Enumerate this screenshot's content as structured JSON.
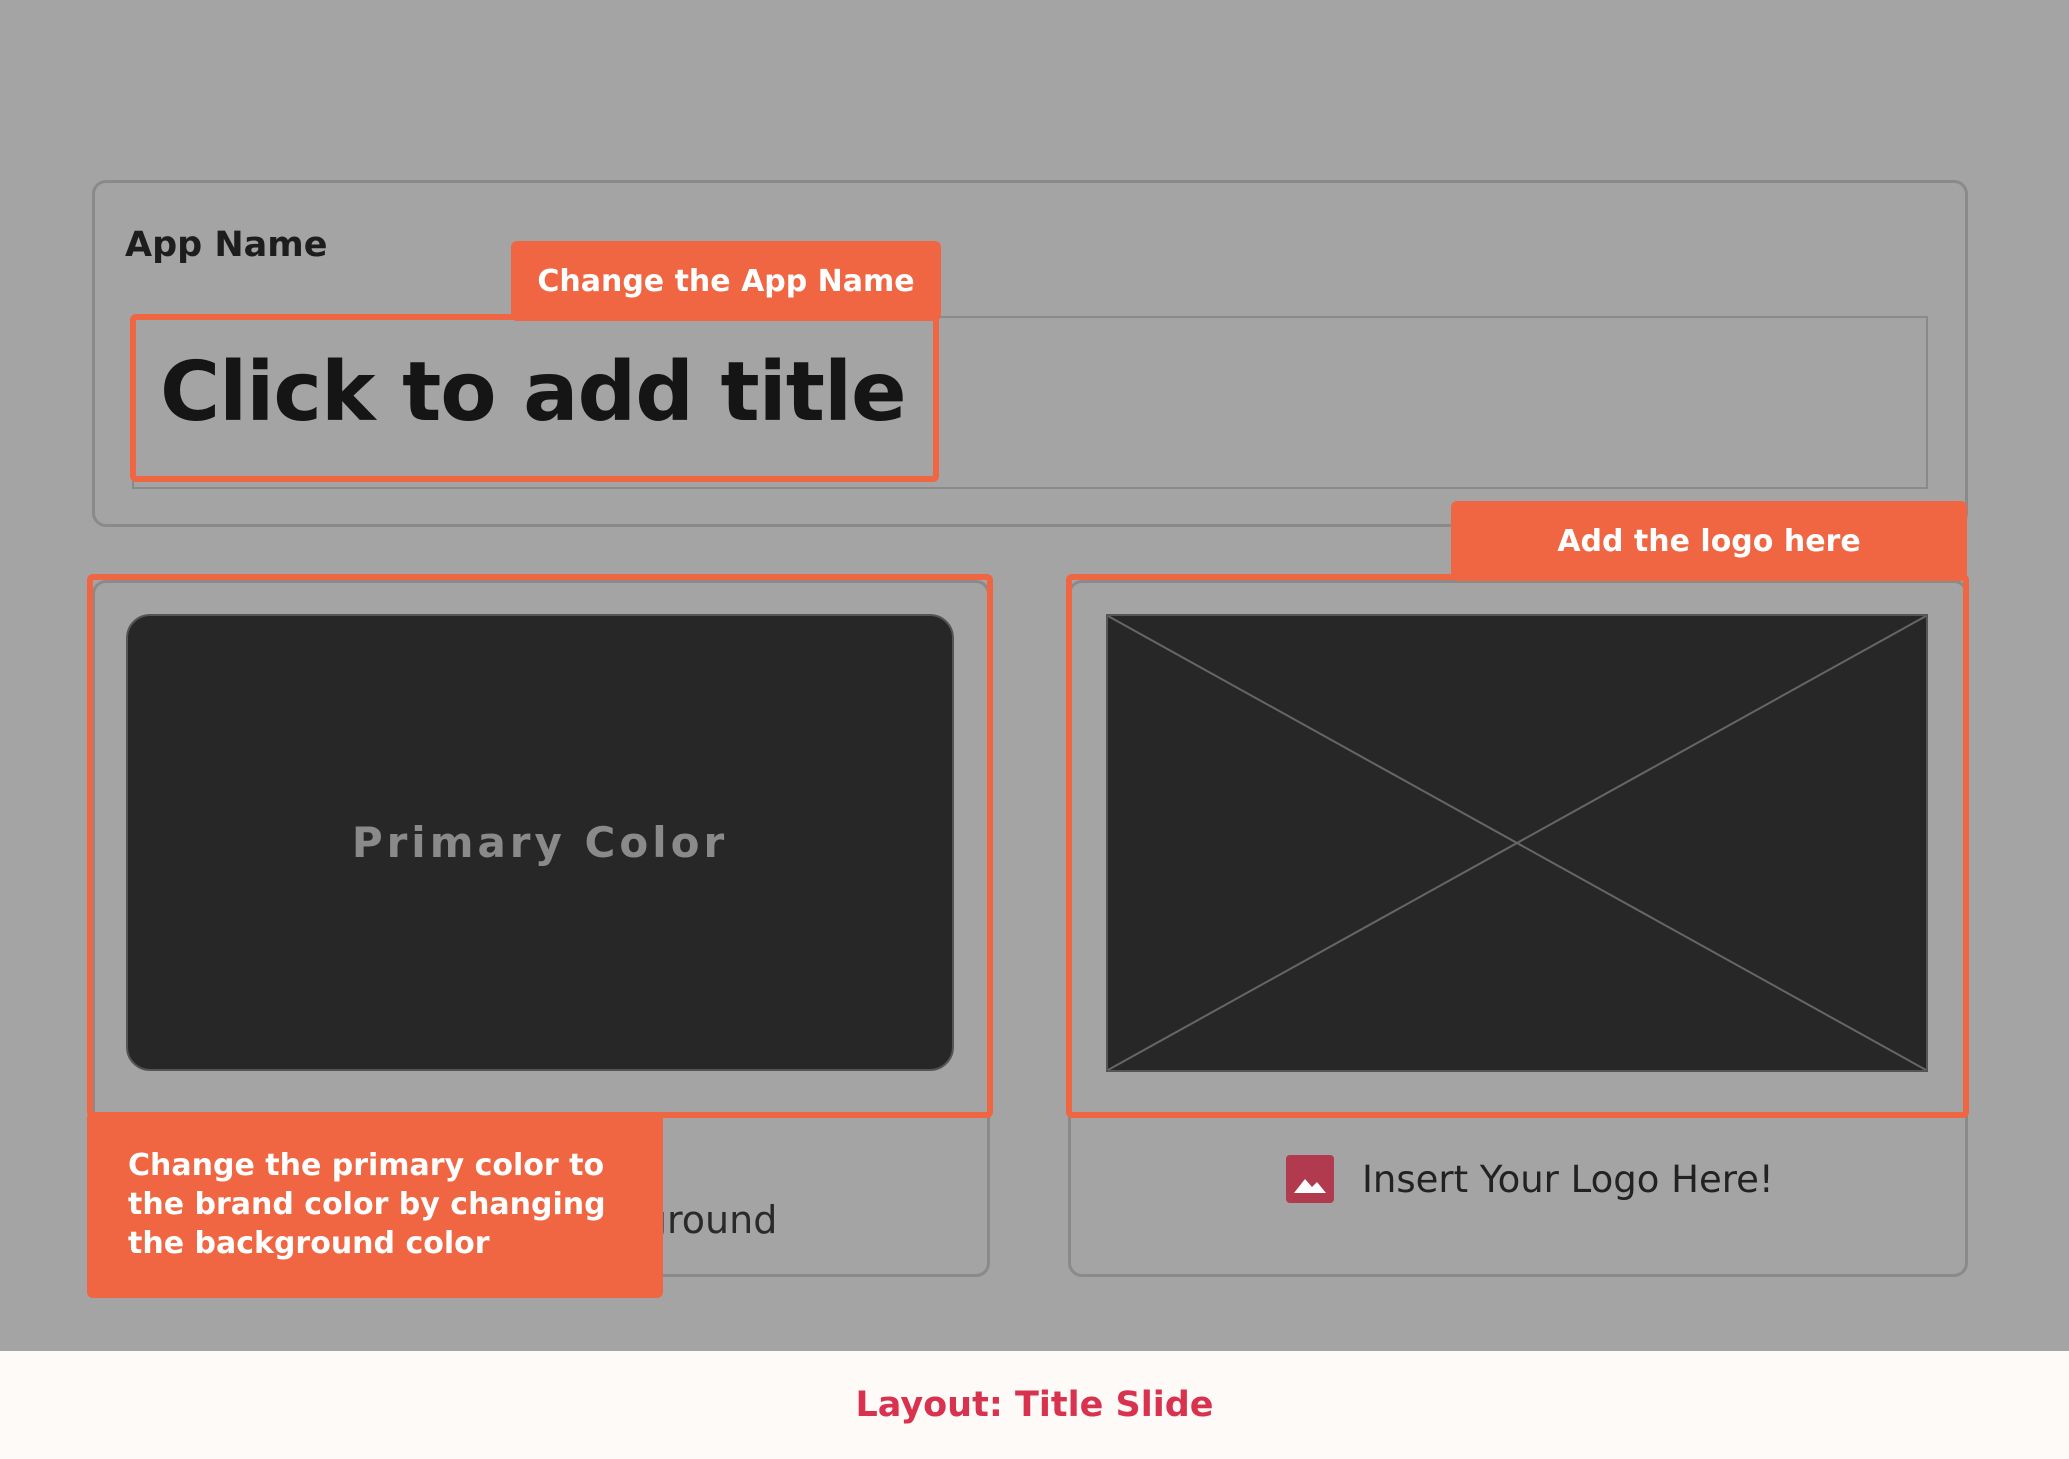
{
  "app_name": {
    "label": "App Name",
    "title_placeholder": "Click to add title"
  },
  "primary_color": {
    "swatch_label": "Primary Color",
    "background_text": "ckground"
  },
  "logo": {
    "caption": "Insert Your Logo Here!",
    "icon": "image-icon"
  },
  "annotations": {
    "app_name": "Change the App Name",
    "logo": "Add the logo here",
    "primary_color": "Change the primary color to the brand color by changing the background color"
  },
  "footer": {
    "layout": "Layout: Title Slide"
  },
  "colors": {
    "accent": "#f06642",
    "footer_text": "#d9324f",
    "stage": "#a4a4a4",
    "swatch": "#272727",
    "icon": "#b13a4f"
  }
}
